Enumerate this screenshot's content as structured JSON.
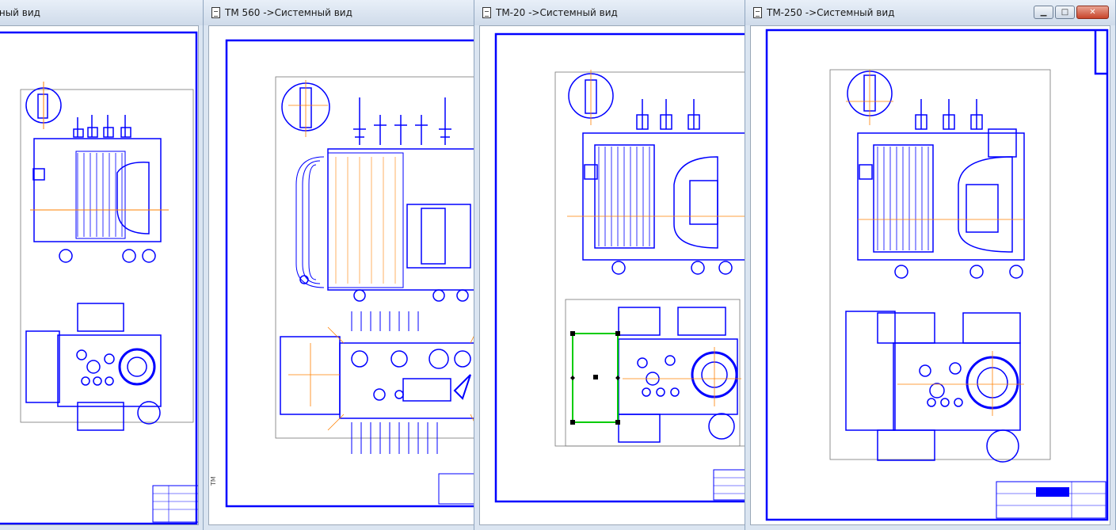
{
  "windows": [
    {
      "id": "w0",
      "title": "нный вид"
    },
    {
      "id": "w1",
      "title": "ТМ 560 ->Системный вид"
    },
    {
      "id": "w2",
      "title": "ТМ-20 ->Системный вид"
    },
    {
      "id": "w3",
      "title": "ТМ-250 ->Системный вид"
    }
  ],
  "active_window_controls": {
    "minimize_icon": "minimize-icon",
    "maximize_icon": "maximize-icon",
    "close_icon": "close-icon"
  },
  "colors": {
    "drawing": "#0000ff",
    "axis": "#ff8000",
    "selection": "#00cc00",
    "background": "#ffffff"
  }
}
